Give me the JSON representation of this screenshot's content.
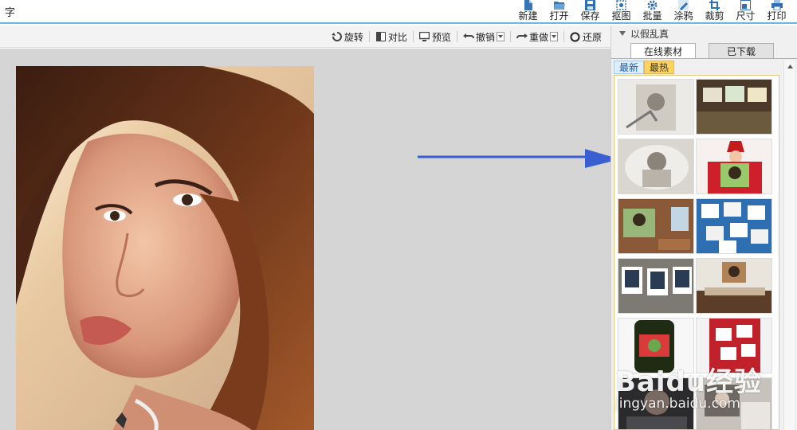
{
  "app": {
    "title": "字"
  },
  "top_toolbar": {
    "items": [
      {
        "label": "新建",
        "icon": "new-file-icon"
      },
      {
        "label": "打开",
        "icon": "open-folder-icon"
      },
      {
        "label": "保存",
        "icon": "save-icon"
      },
      {
        "label": "抠图",
        "icon": "cutout-icon"
      },
      {
        "label": "批量",
        "icon": "batch-gear-icon"
      },
      {
        "label": "涂鸦",
        "icon": "doodle-icon"
      },
      {
        "label": "裁剪",
        "icon": "crop-icon"
      },
      {
        "label": "尺寸",
        "icon": "resize-icon"
      },
      {
        "label": "打印",
        "icon": "print-icon"
      }
    ]
  },
  "edit_toolbar": {
    "rotate": "旋转",
    "compare": "对比",
    "preview": "预览",
    "undo": "撤销",
    "redo": "重做",
    "restore": "还原"
  },
  "panel": {
    "title": "以假乱真",
    "tabs": [
      {
        "label": "在线素材",
        "active": true
      },
      {
        "label": "已下载",
        "active": false
      }
    ],
    "subtabs": [
      {
        "label": "最新",
        "active": false
      },
      {
        "label": "最热",
        "active": true
      }
    ],
    "thumb_count": 12
  },
  "watermark": {
    "logo": "Baidu经验",
    "url": "jingyan.baidu.com"
  },
  "colors": {
    "accent_line": "#6cb6e6",
    "arrow": "#3a5fd0",
    "hot_tab": "#ffd35c",
    "canvas_bg": "#d5d5d5"
  }
}
